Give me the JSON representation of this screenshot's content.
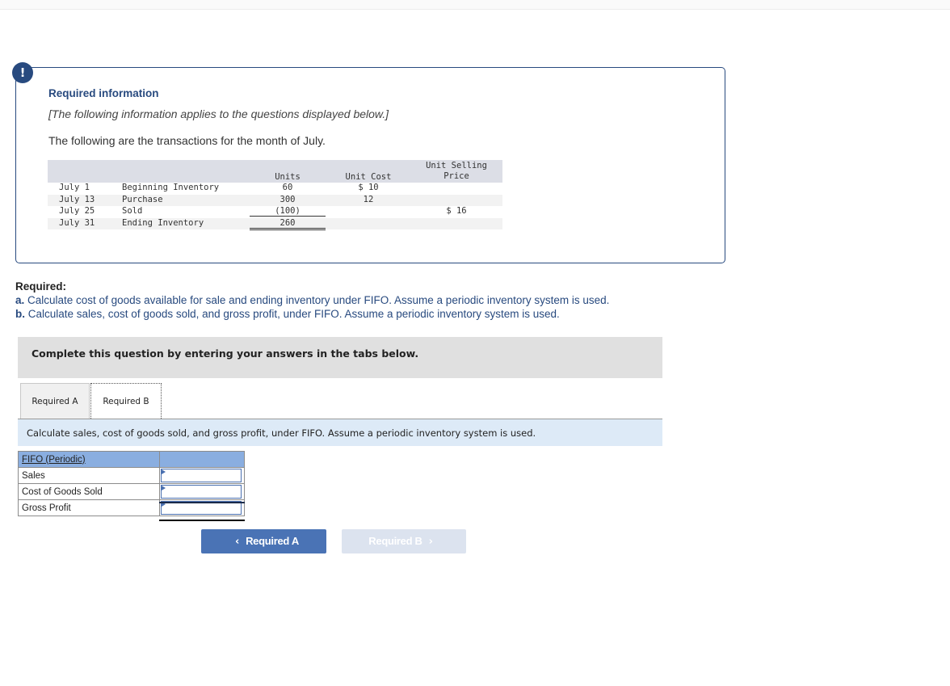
{
  "alert_icon": "!",
  "info": {
    "title": "Required information",
    "note": "[The following information applies to the questions displayed below.]",
    "intro": "The following are the transactions for the month of July."
  },
  "transactions": {
    "headers": {
      "units": "Units",
      "unit_cost": "Unit Cost",
      "unit_selling_price_line1": "Unit Selling",
      "unit_selling_price_line2": "Price"
    },
    "rows": [
      {
        "date": "July 1",
        "description": "Beginning Inventory",
        "units": "60",
        "unit_cost": "$ 10",
        "unit_price": ""
      },
      {
        "date": "July 13",
        "description": "Purchase",
        "units": "300",
        "unit_cost": "12",
        "unit_price": ""
      },
      {
        "date": "July 25",
        "description": "Sold",
        "units": "(100)",
        "unit_cost": "",
        "unit_price": "$ 16"
      },
      {
        "date": "July 31",
        "description": "Ending Inventory",
        "units": "260",
        "unit_cost": "",
        "unit_price": ""
      }
    ]
  },
  "required": {
    "title": "Required:",
    "a_label": "a.",
    "a_text": " Calculate cost of goods available for sale and ending inventory under FIFO. Assume a periodic inventory system is used.",
    "b_label": "b.",
    "b_text": " Calculate sales, cost of goods sold, and gross profit, under FIFO. Assume a periodic inventory system is used."
  },
  "complete_bar": "Complete this question by entering your answers in the tabs below.",
  "tabs": [
    {
      "label": "Required A",
      "active": false
    },
    {
      "label": "Required B",
      "active": true
    }
  ],
  "instruction": "Calculate sales, cost of goods sold, and gross profit, under FIFO. Assume a periodic inventory system is used.",
  "answer_table": {
    "header": "FIFO (Periodic)",
    "rows": [
      {
        "label": "Sales",
        "value": ""
      },
      {
        "label": "Cost of Goods Sold",
        "value": ""
      },
      {
        "label": "Gross Profit",
        "value": ""
      }
    ]
  },
  "nav": {
    "prev_label": "Required A",
    "next_label": "Required B",
    "prev_icon": "‹",
    "next_icon": "›"
  }
}
